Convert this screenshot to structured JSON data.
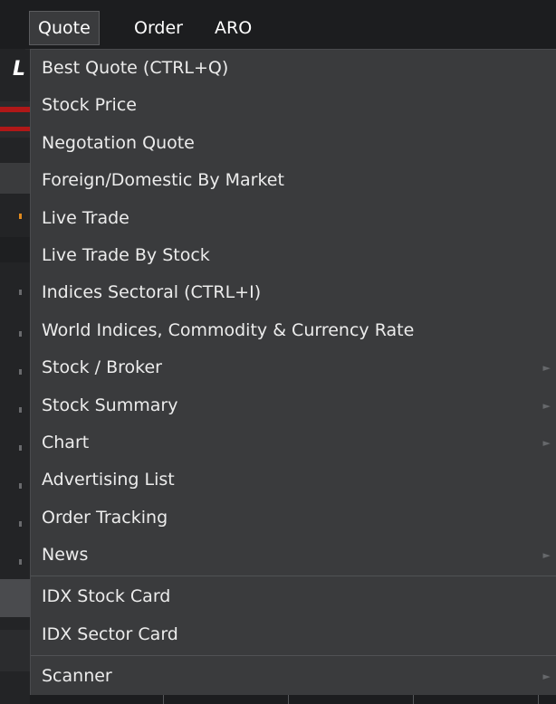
{
  "menubar": {
    "items": [
      {
        "label": "Quote",
        "active": true
      },
      {
        "label": "Order",
        "active": false
      },
      {
        "label": "ARO",
        "active": false
      }
    ]
  },
  "dropdown": {
    "items": [
      {
        "label": "Best Quote (CTRL+Q)",
        "submenu": false
      },
      {
        "label": "Stock Price",
        "submenu": false
      },
      {
        "label": "Negotation Quote",
        "submenu": false
      },
      {
        "label": "Foreign/Domestic By Market",
        "submenu": false
      },
      {
        "label": "Live Trade",
        "submenu": false
      },
      {
        "label": "Live Trade By Stock",
        "submenu": false
      },
      {
        "label": "Indices Sectoral (CTRL+I)",
        "submenu": false
      },
      {
        "label": "World Indices, Commodity & Currency Rate",
        "submenu": false
      },
      {
        "label": "Stock / Broker",
        "submenu": true
      },
      {
        "label": "Stock Summary",
        "submenu": true
      },
      {
        "label": "Chart",
        "submenu": true
      },
      {
        "label": "Advertising List",
        "submenu": false
      },
      {
        "label": "Order Tracking",
        "submenu": false
      },
      {
        "label": "News",
        "submenu": true
      },
      {
        "label": "IDX Stock Card",
        "submenu": false
      },
      {
        "label": "IDX Sector Card",
        "submenu": false
      },
      {
        "label": "Scanner",
        "submenu": true
      }
    ],
    "submenu_arrow": "►"
  },
  "background": {
    "partial_letter": "L"
  },
  "colors": {
    "menu_bg": "#3a3b3d",
    "bar_bg": "#1c1d1f",
    "text": "#ececec",
    "separator": "#505255"
  }
}
